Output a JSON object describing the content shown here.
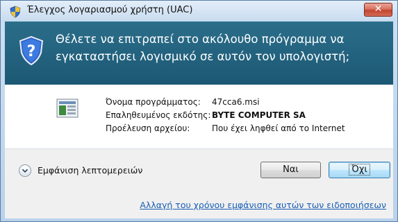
{
  "window": {
    "title": "Έλεγχος λογαριασμού χρήστη (UAC)",
    "close_glyph": "✕"
  },
  "banner": {
    "question_line1": "Θέλετε να επιτραπεί στο ακόλουθο πρόγραμμα να",
    "question_line2": "εγκαταστήσει λογισμικό σε αυτόν τον υπολογιστή;"
  },
  "program_info": {
    "rows": [
      {
        "label": "Όνομα προγράμματος:",
        "value": "47cca6.msi"
      },
      {
        "label": "Επαληθευμένος εκδότης:",
        "value": "BYTE COMPUTER SA"
      },
      {
        "label": "Προέλευση αρχείου:",
        "value": "Που έχει ληφθεί από το Internet"
      }
    ]
  },
  "footer": {
    "details_label": "Εμφάνιση λεπτομερειών",
    "yes_label": "Ναι",
    "no_label": "Όχι",
    "notification_link": "Αλλαγή του χρόνου εμφάνισης αυτών των ειδοποιήσεων"
  },
  "colors": {
    "banner": "#1c5874",
    "link": "#1a5fb4",
    "close_button": "#c24530"
  },
  "icons": [
    "uac-shield-icon",
    "close-icon",
    "help-shield-icon",
    "installer-package-icon",
    "chevron-down-icon"
  ]
}
